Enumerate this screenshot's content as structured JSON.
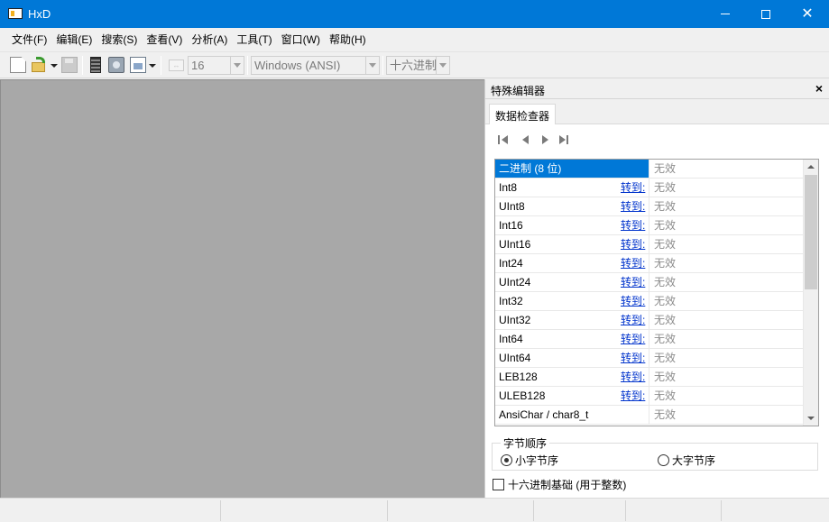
{
  "window": {
    "title": "HxD",
    "logo_text": "HxD"
  },
  "menu": [
    {
      "label": "文件(F)"
    },
    {
      "label": "编辑(E)"
    },
    {
      "label": "搜索(S)"
    },
    {
      "label": "查看(V)"
    },
    {
      "label": "分析(A)"
    },
    {
      "label": "工具(T)"
    },
    {
      "label": "窗口(W)"
    },
    {
      "label": "帮助(H)"
    }
  ],
  "toolbar": {
    "columns_value": "16",
    "charset_value": "Windows (ANSI)",
    "offset_base_value": "十六进制",
    "icons": [
      "new-file-icon",
      "open-file-icon",
      "save-icon",
      "open-ram-icon",
      "open-disk-icon",
      "open-process-icon",
      "bytes-per-row-icon"
    ]
  },
  "panel": {
    "title": "特殊编辑器",
    "close_symbol": "×",
    "tab_label": "数据检查器",
    "goto_label": "转到:",
    "rows": [
      {
        "name": "二进制 (8 位)",
        "value": "无效"
      },
      {
        "name": "Int8",
        "value": "无效"
      },
      {
        "name": "UInt8",
        "value": "无效"
      },
      {
        "name": "Int16",
        "value": "无效"
      },
      {
        "name": "UInt16",
        "value": "无效"
      },
      {
        "name": "Int24",
        "value": "无效"
      },
      {
        "name": "UInt24",
        "value": "无效"
      },
      {
        "name": "Int32",
        "value": "无效"
      },
      {
        "name": "UInt32",
        "value": "无效"
      },
      {
        "name": "Int64",
        "value": "无效"
      },
      {
        "name": "UInt64",
        "value": "无效"
      },
      {
        "name": "LEB128",
        "value": "无效"
      },
      {
        "name": "ULEB128",
        "value": "无效"
      },
      {
        "name": "AnsiChar / char8_t",
        "value": "无效"
      }
    ],
    "byte_order": {
      "legend": "字节顺序",
      "little_endian": "小字节序",
      "big_endian": "大字节序",
      "selected": "little_endian"
    },
    "hex_basis_label": "十六进制基础 (用于整数)",
    "hex_basis_checked": false
  },
  "colors": {
    "titlebar": "#0078d7",
    "selection": "#0078d7",
    "editor_bg": "#a8a8a8",
    "link": "#0033cc",
    "invalid_text": "#8c8c8c"
  }
}
